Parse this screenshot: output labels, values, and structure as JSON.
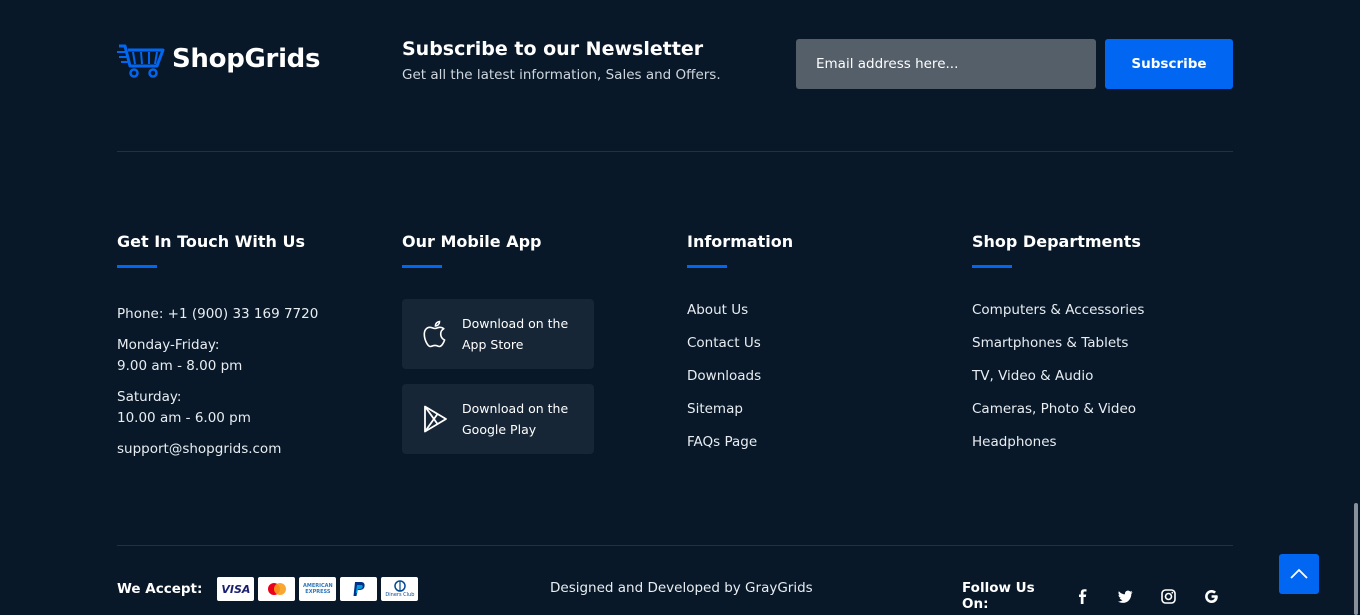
{
  "brand": {
    "name": "ShopGrids"
  },
  "newsletter": {
    "title": "Subscribe to our Newsletter",
    "subtitle": "Get all the latest information, Sales and Offers.",
    "email_placeholder": "Email address here...",
    "subscribe_label": "Subscribe"
  },
  "contact": {
    "title": "Get In Touch With Us",
    "phone": "Phone: +1 (900) 33 169 7720",
    "weekday_label": "Monday-Friday:",
    "weekday_hours": "9.00 am - 8.00 pm",
    "saturday_label": "Saturday:",
    "saturday_hours": "10.00 am - 6.00 pm",
    "email": "support@shopgrids.com"
  },
  "mobile_app": {
    "title": "Our Mobile App",
    "app_store": {
      "line1": "Download on the",
      "line2": "App Store",
      "icon": "apple-icon"
    },
    "google_play": {
      "line1": "Download on the",
      "line2": "Google Play",
      "icon": "play-store-icon"
    }
  },
  "information": {
    "title": "Information",
    "links": [
      "About Us",
      "Contact Us",
      "Downloads",
      "Sitemap",
      "FAQs Page"
    ]
  },
  "departments": {
    "title": "Shop Departments",
    "links": [
      "Computers & Accessories",
      "Smartphones & Tablets",
      "TV, Video & Audio",
      "Cameras, Photo & Video",
      "Headphones"
    ]
  },
  "bottom": {
    "accept_label": "We Accept:",
    "cards": [
      "visa",
      "mastercard",
      "american-express",
      "paypal",
      "diners-club"
    ],
    "visa_text": "VISA",
    "amex_text": "AMERICAN EXPRESS",
    "diners_text": "Diners Club",
    "credit": "Designed and Developed by GrayGrids",
    "follow_label": "Follow Us On:",
    "social": [
      "facebook-icon",
      "twitter-icon",
      "instagram-icon",
      "google-icon"
    ]
  },
  "colors": {
    "background": "#081828",
    "accent": "#0167f3",
    "input_bg": "#555f69",
    "card_bg": "#172636"
  }
}
